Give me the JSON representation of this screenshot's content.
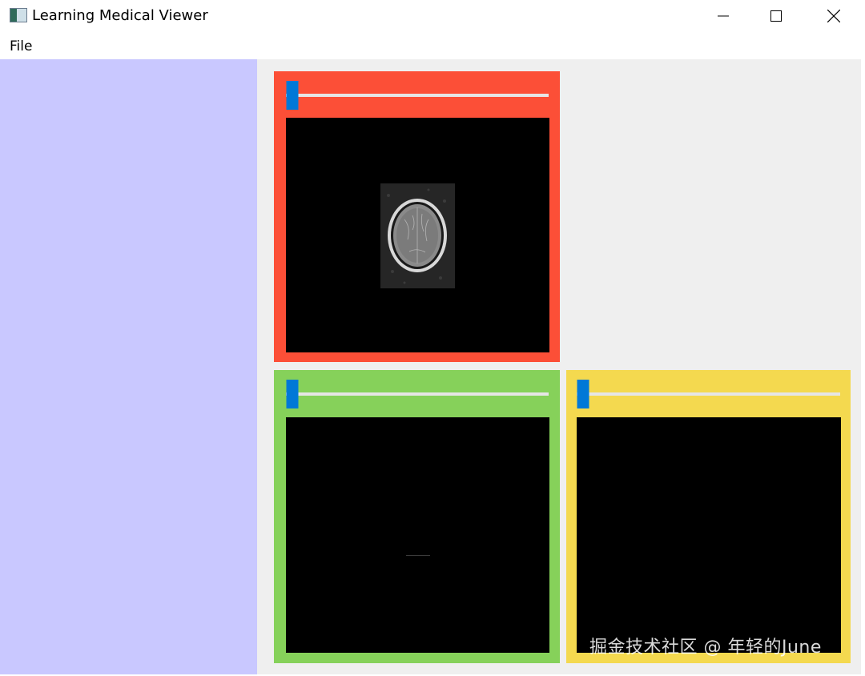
{
  "window": {
    "title": "Learning Medical Viewer"
  },
  "menubar": {
    "items": [
      {
        "label": "File"
      }
    ]
  },
  "colors": {
    "sidebar": "#c9c8ff",
    "panel_red": "#fc4f37",
    "panel_green": "#86d15a",
    "panel_yellow": "#f4d94f",
    "slider_handle": "#0078d7",
    "view_background": "#000000"
  },
  "panels": [
    {
      "name": "red",
      "slider_value_fraction": 0.0,
      "image": "mri-axial-brain-slice"
    },
    {
      "name": "green",
      "slider_value_fraction": 0.0,
      "image": "blank"
    },
    {
      "name": "yellow",
      "slider_value_fraction": 0.0,
      "image": "blank"
    }
  ],
  "watermark": "掘金技术社区 @ 年轻的June"
}
